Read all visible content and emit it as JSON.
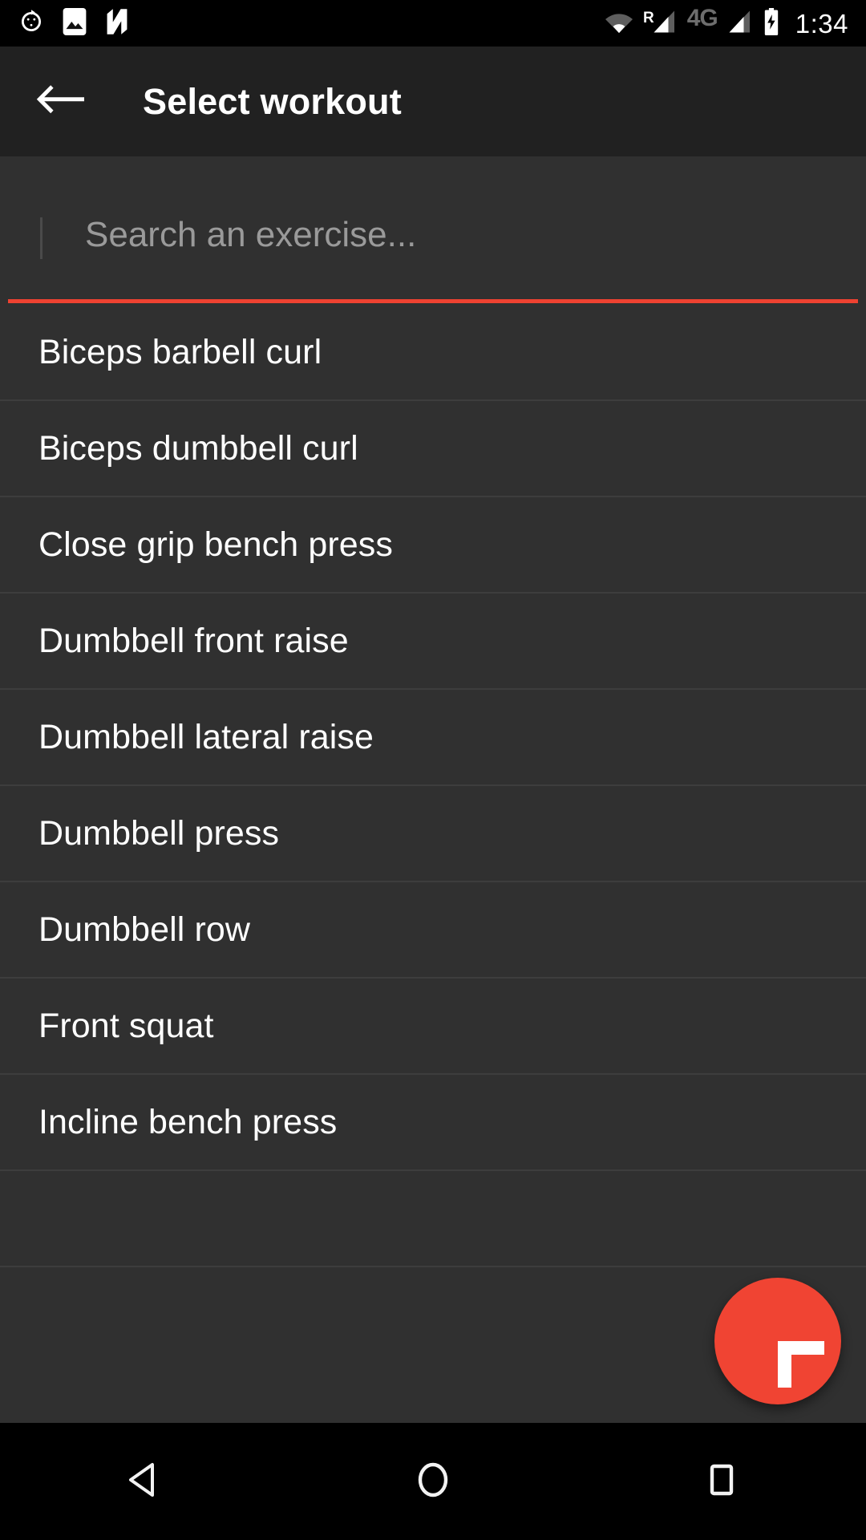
{
  "status_bar": {
    "left_icons": [
      "alarm-timer-icon",
      "photos-icon",
      "nova-launcher-icon"
    ],
    "wifi_icon": "wifi-icon",
    "roaming_label": "R",
    "roaming_signal_icon": "cell-signal-icon",
    "network_type": "4G",
    "signal_icon": "cell-signal-icon",
    "battery_icon": "battery-charging-icon",
    "clock": "1:34"
  },
  "app_bar": {
    "back_icon": "arrow-left-icon",
    "title": "Select workout"
  },
  "search": {
    "value": "",
    "placeholder": "Search an exercise...",
    "underline_color": "#ee4231"
  },
  "exercise_list": {
    "items": [
      {
        "label": "Biceps barbell curl"
      },
      {
        "label": "Biceps dumbbell curl"
      },
      {
        "label": "Close grip bench press"
      },
      {
        "label": "Dumbbell front raise"
      },
      {
        "label": "Dumbbell lateral raise"
      },
      {
        "label": "Dumbbell press"
      },
      {
        "label": "Dumbbell row"
      },
      {
        "label": "Front squat"
      },
      {
        "label": "Incline bench press"
      },
      {
        "label": ""
      }
    ]
  },
  "fab": {
    "icon": "plus-icon",
    "color": "#f04433"
  },
  "nav_bar": {
    "back_icon": "nav-back-triangle-icon",
    "home_icon": "nav-home-circle-icon",
    "recents_icon": "nav-recents-square-icon"
  },
  "theme": {
    "status_bar_bg": "#000000",
    "app_bar_bg": "#212121",
    "content_bg": "#303030",
    "divider": "#3d3d3d",
    "text_primary": "#ffffff",
    "text_hint": "#9a9a9a",
    "accent": "#ee4231"
  }
}
